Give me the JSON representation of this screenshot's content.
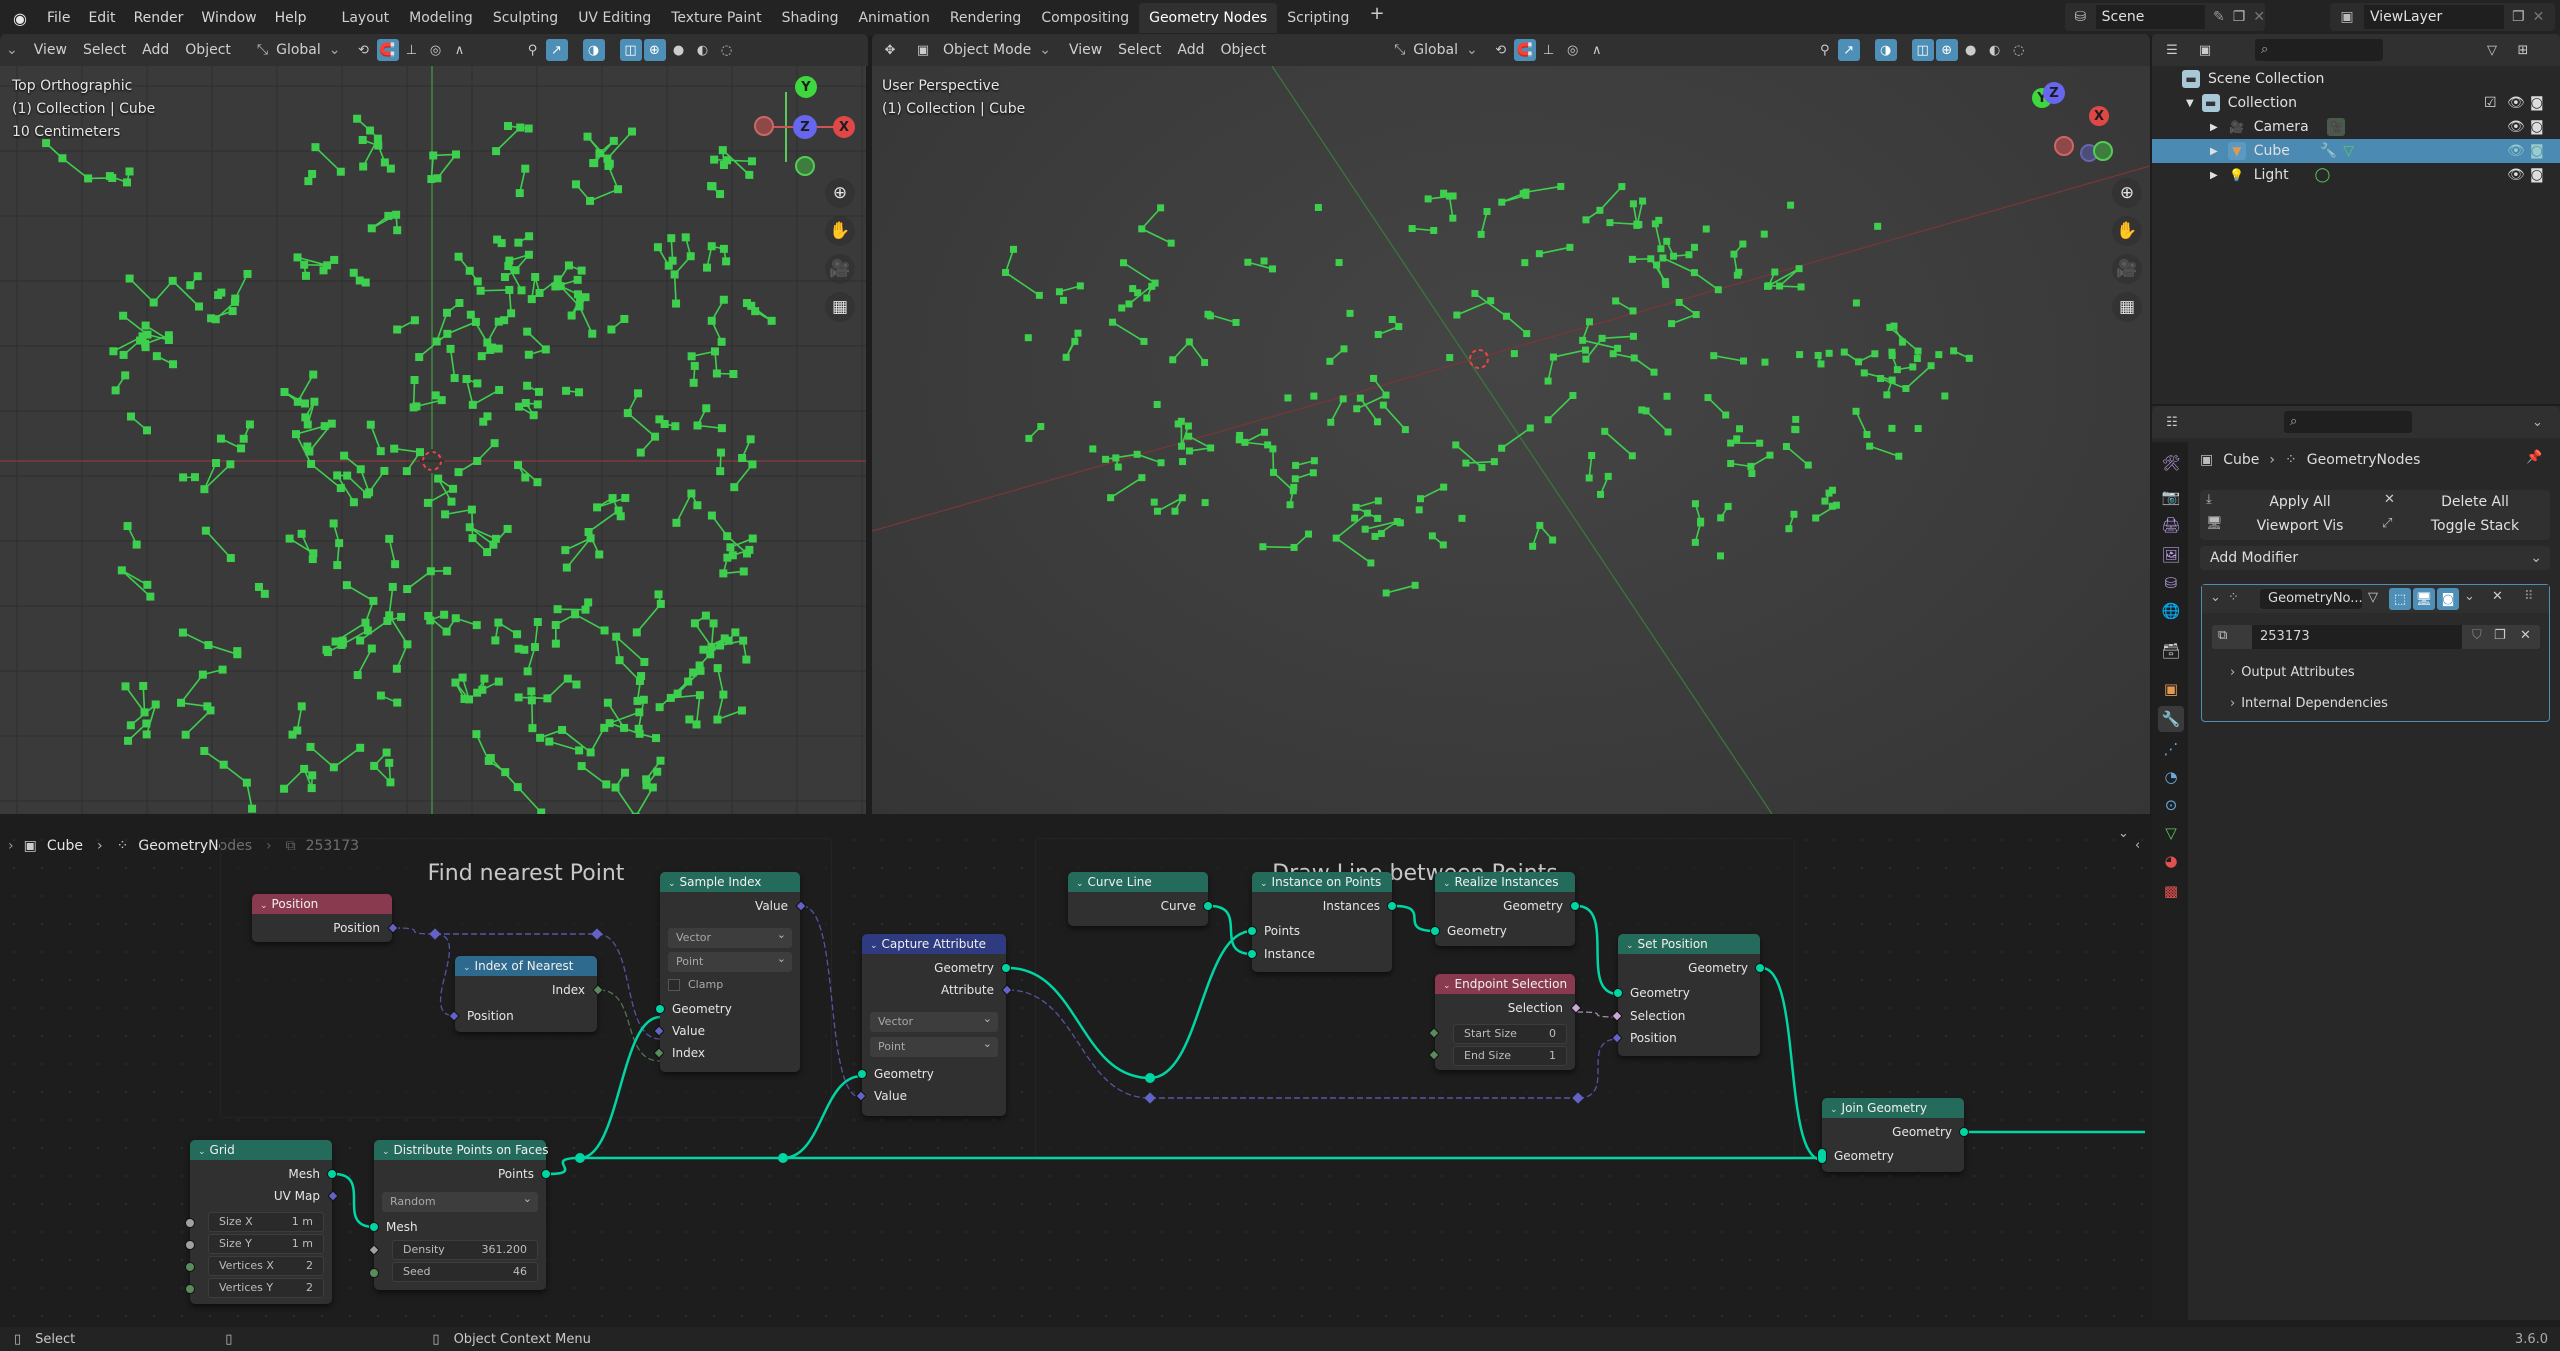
{
  "topbar": {
    "menus": [
      "File",
      "Edit",
      "Render",
      "Window",
      "Help"
    ],
    "workspaces": [
      "Layout",
      "Modeling",
      "Sculpting",
      "UV Editing",
      "Texture Paint",
      "Shading",
      "Animation",
      "Rendering",
      "Compositing",
      "Geometry Nodes",
      "Scripting"
    ],
    "active_workspace": "Geometry Nodes",
    "scene": "Scene",
    "view_layer": "ViewLayer"
  },
  "viewport_left": {
    "menus": [
      "View",
      "Select",
      "Add",
      "Object"
    ],
    "orientation": "Global",
    "overlay_lines": [
      "Top Orthographic",
      "(1) Collection | Cube",
      "10 Centimeters"
    ]
  },
  "viewport_right": {
    "mode": "Object Mode",
    "menus": [
      "View",
      "Select",
      "Add",
      "Object"
    ],
    "orientation": "Global",
    "overlay_lines": [
      "User Perspective",
      "(1) Collection | Cube"
    ]
  },
  "gizmo": {
    "x": "X",
    "y": "Y",
    "z": "Z"
  },
  "outliner": {
    "items": [
      {
        "label": "Scene Collection",
        "level": 0
      },
      {
        "label": "Collection",
        "level": 1
      },
      {
        "label": "Camera",
        "level": 2
      },
      {
        "label": "Cube",
        "level": 2,
        "selected": true
      },
      {
        "label": "Light",
        "level": 2
      }
    ]
  },
  "properties": {
    "breadcrumb": [
      "Cube",
      "GeometryNodes"
    ],
    "apply_all": "Apply All",
    "delete_all": "Delete All",
    "viewport_vis": "Viewport Vis",
    "toggle_stack": "Toggle Stack",
    "add_modifier": "Add Modifier",
    "modifier_name": "GeometryNo...",
    "node_group": "253173",
    "panels": [
      "Output Attributes",
      "Internal Dependencies"
    ]
  },
  "node_editor": {
    "breadcrumb": [
      "Cube",
      "GeometryNodes",
      "253173"
    ],
    "frames": [
      "Find nearest Point",
      "Draw Line between Points"
    ],
    "nodes": {
      "position": {
        "title": "Position",
        "out": "Position"
      },
      "index_nearest": {
        "title": "Index of Nearest",
        "out": "Index",
        "in": "Position"
      },
      "sample_index": {
        "title": "Sample Index",
        "out": "Value",
        "type": "Vector",
        "domain": "Point",
        "clamp": "Clamp",
        "inputs": [
          "Geometry",
          "Value",
          "Index"
        ]
      },
      "capture": {
        "title": "Capture Attribute",
        "outs": [
          "Geometry",
          "Attribute"
        ],
        "type": "Vector",
        "domain": "Point",
        "inputs": [
          "Geometry",
          "Value"
        ]
      },
      "curve_line": {
        "title": "Curve Line",
        "out": "Curve"
      },
      "instance_on_points": {
        "title": "Instance on Points",
        "out": "Instances",
        "inputs": [
          "Points",
          "Instance"
        ]
      },
      "realize": {
        "title": "Realize Instances",
        "out": "Geometry",
        "in": "Geometry"
      },
      "endpoint": {
        "title": "Endpoint Selection",
        "out": "Selection",
        "start_label": "Start Size",
        "start_value": "0",
        "end_label": "End Size",
        "end_value": "1"
      },
      "set_position": {
        "title": "Set Position",
        "out": "Geometry",
        "inputs": [
          "Geometry",
          "Selection",
          "Position"
        ]
      },
      "join": {
        "title": "Join Geometry",
        "out": "Geometry",
        "in": "Geometry"
      },
      "grid": {
        "title": "Grid",
        "outs": [
          "Mesh",
          "UV Map"
        ],
        "fields": [
          [
            "Size X",
            "1 m"
          ],
          [
            "Size Y",
            "1 m"
          ],
          [
            "Vertices X",
            "2"
          ],
          [
            "Vertices Y",
            "2"
          ]
        ]
      },
      "distribute": {
        "title": "Distribute Points on Faces",
        "out": "Points",
        "mode": "Random",
        "in": "Mesh",
        "fields": [
          [
            "Density",
            "361.200"
          ],
          [
            "Seed",
            "46"
          ]
        ]
      }
    }
  },
  "statusbar": {
    "select": "Select",
    "context": "Object Context Menu",
    "version": "3.6.0"
  },
  "colors": {
    "accent": "#4a8ab3",
    "geometry_socket": "#00d6a3",
    "vector_socket": "#6363c7",
    "int_socket": "#598c5c",
    "bool_socket": "#cca6d6",
    "points": "#3ecf4e"
  }
}
